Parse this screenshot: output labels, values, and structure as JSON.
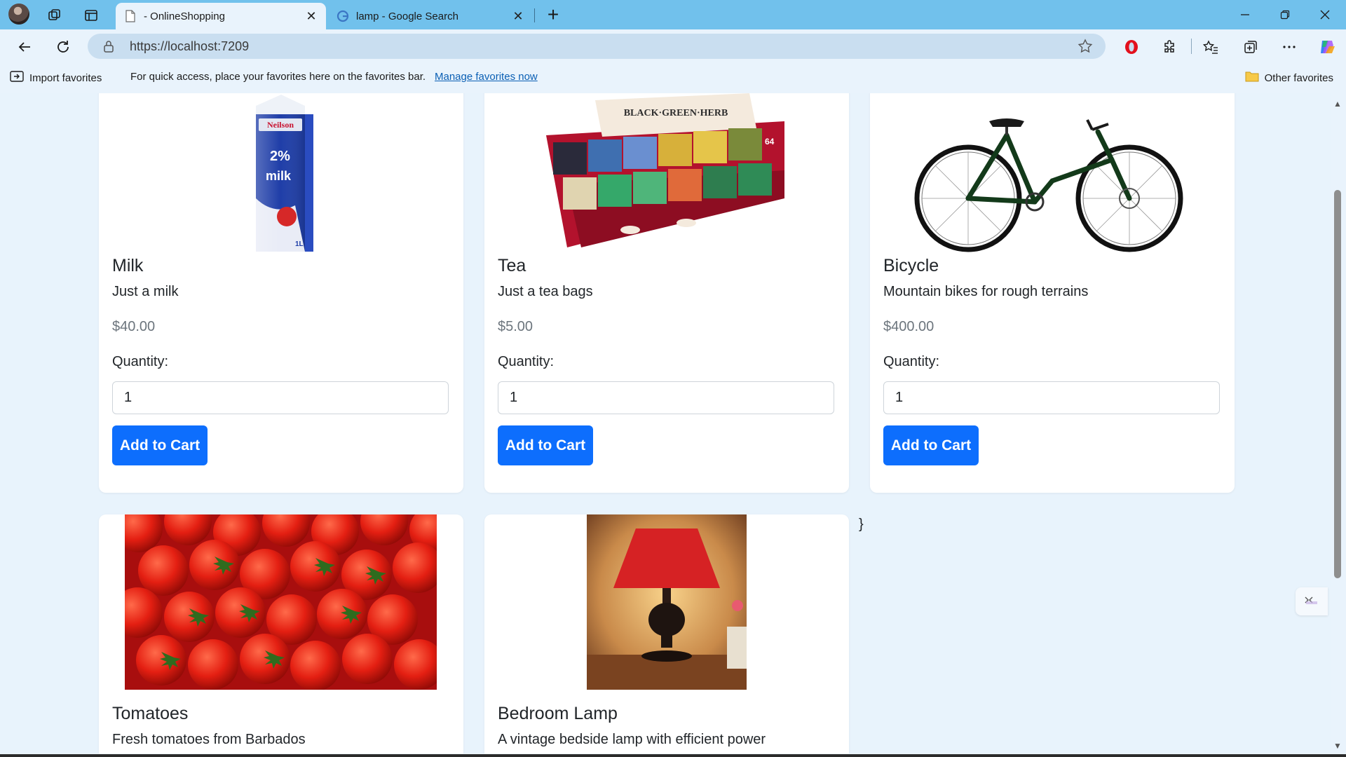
{
  "browser": {
    "tabs": [
      {
        "label": "- OnlineShopping",
        "active": true,
        "icon": "page-icon"
      },
      {
        "label": "lamp - Google Search",
        "active": false,
        "icon": "google-icon"
      }
    ],
    "address": {
      "url": "https://localhost:7209"
    },
    "favorites_bar": {
      "import_label": "Import favorites",
      "message": "For quick access, place your favorites here on the favorites bar.",
      "manage_link": "Manage favorites now",
      "other_label": "Other favorites"
    }
  },
  "products": [
    {
      "name": "Milk",
      "description": "Just a milk",
      "price": "$40.00",
      "quantity_label": "Quantity:",
      "quantity": "1",
      "button": "Add to Cart"
    },
    {
      "name": "Tea",
      "description": "Just a tea bags",
      "price": "$5.00",
      "quantity_label": "Quantity:",
      "quantity": "1",
      "button": "Add to Cart"
    },
    {
      "name": "Bicycle",
      "description": "Mountain bikes for rough terrains",
      "price": "$400.00",
      "quantity_label": "Quantity:",
      "quantity": "1",
      "button": "Add to Cart"
    },
    {
      "name": "Tomatoes",
      "description": "Fresh tomatoes from Barbados"
    },
    {
      "name": "Bedroom Lamp",
      "description": "A vintage bedside lamp with efficient power"
    }
  ],
  "image_text": {
    "milk_brand": "Neilson",
    "milk_fat": "2%",
    "milk_word": "milk",
    "milk_size": "1L",
    "tea_banner": "BLACK·GREEN·HERB",
    "tea_count": "64"
  },
  "stray_text": "}",
  "colors": {
    "accent": "#0d6efd",
    "titlebar": "#71c1ec",
    "page_bg": "#e8f3fc"
  }
}
